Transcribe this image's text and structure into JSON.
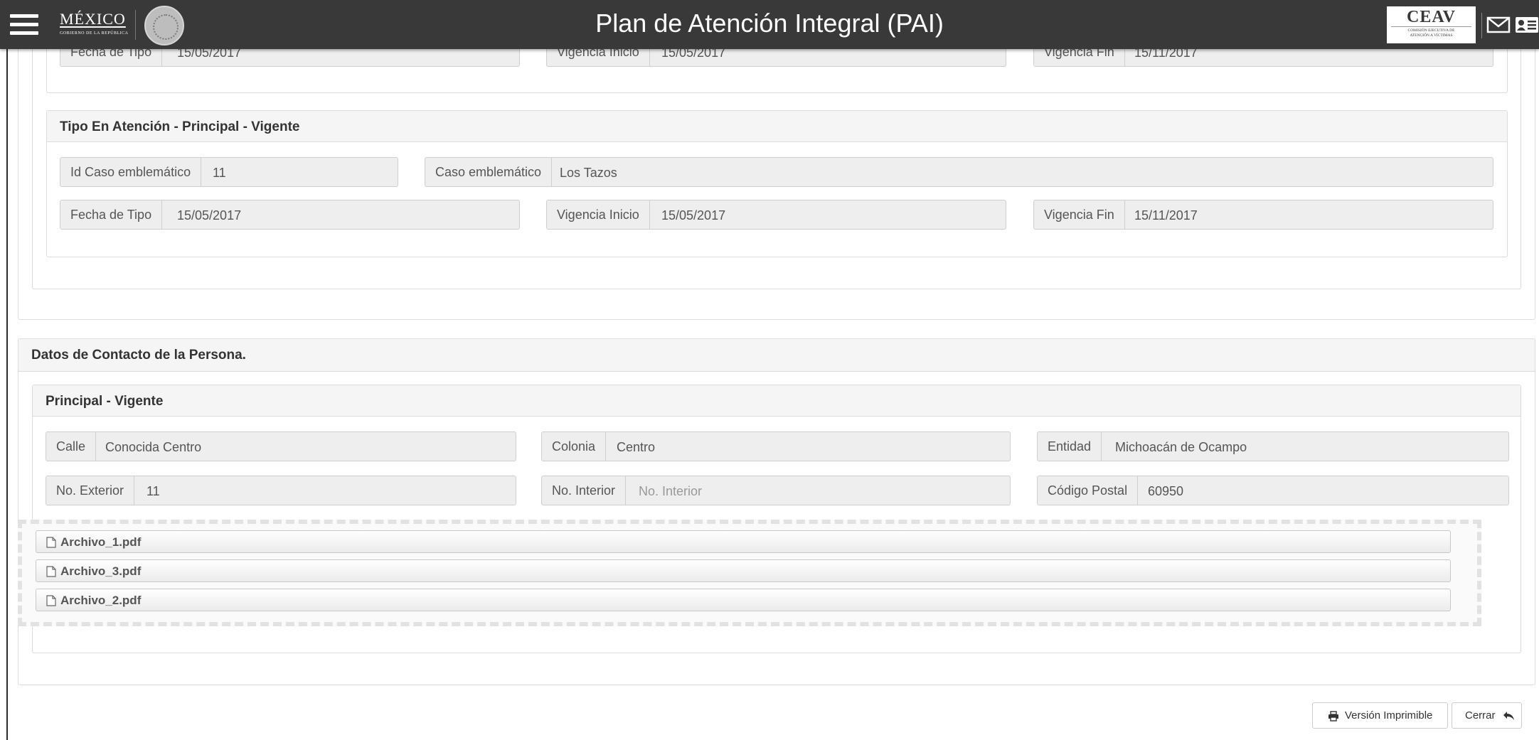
{
  "header": {
    "title": "Plan de Atención Integral (PAI)",
    "gov_logo": "MÉXICO",
    "gov_subtitle": "GOBIERNO DE LA REPÚBLICA",
    "agency_logo": "CEAV",
    "agency_subtitle_1": "COMISIÓN EJECUTIVA DE",
    "agency_subtitle_2": "ATENCIÓN A VÍCTIMAS",
    "icons": [
      "menu-icon",
      "seal-icon",
      "mail-icon",
      "user-card-icon"
    ]
  },
  "tipo_anterior": {
    "fecha_tipo_label": "Fecha de Tipo",
    "fecha_tipo_value": "15/05/2017",
    "vigencia_inicio_label": "Vigencia Inicio",
    "vigencia_inicio_value": "15/05/2017",
    "vigencia_fin_label": "Vigencia Fin",
    "vigencia_fin_value": "15/11/2017"
  },
  "tipo_atencion": {
    "heading": "Tipo En Atención - Principal - Vigente",
    "id_caso_label": "Id Caso emblemático",
    "id_caso_value": "11",
    "caso_label": "Caso emblemático",
    "caso_value": "Los Tazos",
    "fecha_tipo_label": "Fecha de Tipo",
    "fecha_tipo_value": "15/05/2017",
    "vigencia_inicio_label": "Vigencia Inicio",
    "vigencia_inicio_value": "15/05/2017",
    "vigencia_fin_label": "Vigencia Fin",
    "vigencia_fin_value": "15/11/2017"
  },
  "contacto": {
    "heading": "Datos de Contacto de la Persona.",
    "sub_heading": "Principal - Vigente",
    "calle_label": "Calle",
    "calle_value": "Conocida Centro",
    "colonia_label": "Colonia",
    "colonia_value": "Centro",
    "entidad_label": "Entidad",
    "entidad_value": "Michoacán de Ocampo",
    "no_exterior_label": "No. Exterior",
    "no_exterior_value": "11",
    "no_interior_label": "No. Interior",
    "no_interior_placeholder": "No. Interior",
    "codigo_postal_label": "Código Postal",
    "codigo_postal_value": "60950",
    "files": [
      "Archivo_1.pdf",
      "Archivo_3.pdf",
      "Archivo_2.pdf"
    ],
    "file_icon": "file-icon"
  },
  "footer": {
    "print_label": "Versión Imprimible",
    "print_icon": "printer-icon",
    "close_label": "Cerrar",
    "close_icon": "reply-icon"
  },
  "colors": {
    "header_bg": "#393939",
    "panel_heading_bg": "#f5f5f5",
    "input_bg": "#eeeeee",
    "border": "#dcdcdc"
  }
}
